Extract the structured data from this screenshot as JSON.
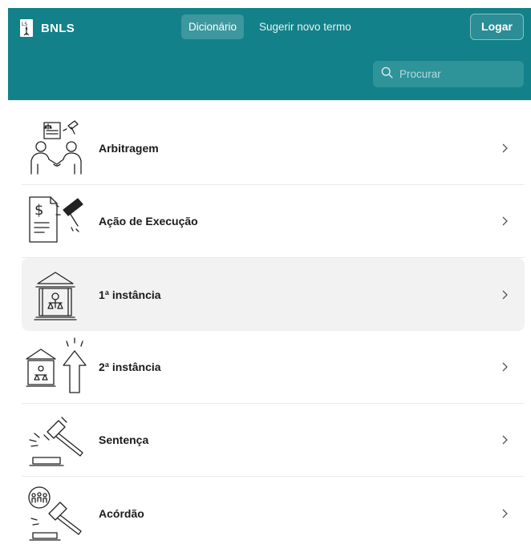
{
  "brand": {
    "name": "BNLS",
    "logo_icon": "book-logo-icon"
  },
  "nav": [
    {
      "label": "Dicionário",
      "active": true
    },
    {
      "label": "Sugerir novo termo",
      "active": false
    }
  ],
  "login": {
    "label": "Logar"
  },
  "search": {
    "placeholder": "Procurar",
    "value": "",
    "icon": "search-icon"
  },
  "colors": {
    "header": "#138189",
    "search_bg": "#2f939a",
    "highlight_row": "#f2f2f2"
  },
  "entries": [
    {
      "label": "Arbitragem",
      "icon": "handshake-contract-icon"
    },
    {
      "label": "Ação de Execução",
      "icon": "invoice-gavel-icon"
    },
    {
      "label": "1ª instância",
      "icon": "courthouse-scales-icon",
      "highlighted": true
    },
    {
      "label": "2ª instância",
      "icon": "courthouse-arrow-up-icon"
    },
    {
      "label": "Sentença",
      "icon": "gavel-icon"
    },
    {
      "label": "Acórdão",
      "icon": "gavel-people-icon"
    }
  ]
}
